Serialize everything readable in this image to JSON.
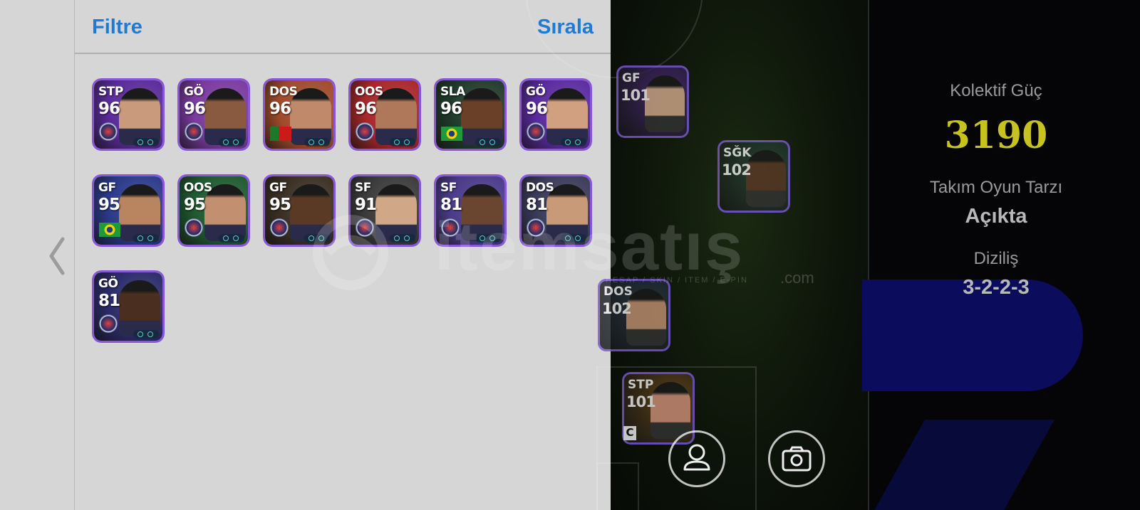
{
  "header": {
    "filter_label": "Filtre",
    "sort_label": "Sırala"
  },
  "colors": {
    "accent": "#1f7ad6",
    "panel_bg": "#d6d6d6",
    "power": "#c8c21e"
  },
  "player_list": [
    {
      "position": "STP",
      "rating": "96",
      "bg": "#5a2a9a",
      "face": "#c99a7c",
      "emblem": "psg-crest-icon"
    },
    {
      "position": "GÖ",
      "rating": "96",
      "bg": "#7a3aa0",
      "face": "#8a5a40",
      "emblem": "psg-crest-icon"
    },
    {
      "position": "DOS",
      "rating": "96",
      "bg": "#a04a2a",
      "face": "#c08a6a",
      "emblem": "portugal-flag-icon"
    },
    {
      "position": "OOS",
      "rating": "96",
      "bg": "#a8262a",
      "face": "#b0785a",
      "emblem": "red-crest-icon"
    },
    {
      "position": "SLA",
      "rating": "96",
      "bg": "#1f3a2a",
      "face": "#6a4028",
      "emblem": "brazil-flag-icon"
    },
    {
      "position": "GÖ",
      "rating": "96",
      "bg": "#5a2aa0",
      "face": "#d0a080",
      "emblem": "barcelona-crest-icon"
    },
    {
      "position": "GF",
      "rating": "95",
      "bg": "#2a3a8a",
      "face": "#b88560",
      "emblem": "brazil-flag-icon"
    },
    {
      "position": "OOS",
      "rating": "95",
      "bg": "#1e5a2e",
      "face": "#c29070",
      "emblem": "purple-crest-icon"
    },
    {
      "position": "GF",
      "rating": "95",
      "bg": "#3a2e22",
      "face": "#5a3a24",
      "emblem": "psg-crest-icon"
    },
    {
      "position": "SF",
      "rating": "91",
      "bg": "#3a3a3a",
      "face": "#d0a888",
      "emblem": "red-crest-icon"
    },
    {
      "position": "SF",
      "rating": "81",
      "bg": "#4a3a8a",
      "face": "#6a4530",
      "emblem": "blue-crest-icon"
    },
    {
      "position": "DOS",
      "rating": "81",
      "bg": "#3a3a5a",
      "face": "#c89a78",
      "emblem": "galatasaray-crest-icon"
    },
    {
      "position": "GÖ",
      "rating": "81",
      "bg": "#2a2a6a",
      "face": "#4a2e20",
      "emblem": "fenerbahce-crest-icon"
    }
  ],
  "pitch_cards": [
    {
      "position": "GF",
      "rating": "101",
      "bg": "#4a2a7a",
      "face": "#d0a88a"
    },
    {
      "position": "SĞK",
      "rating": "102",
      "bg": "#2a4a3a",
      "face": "#5a3a26"
    },
    {
      "position": "DOS",
      "rating": "102",
      "bg": "#2a3a4a",
      "face": "#c09070"
    },
    {
      "position": "STP",
      "rating": "101",
      "bg": "#6a4a1a",
      "face": "#d0907a",
      "badge": "C"
    }
  ],
  "team_stats": {
    "power_label": "Kolektif Güç",
    "power_value": "3190",
    "style_label": "Takım Oyun Tarzı",
    "style_value": "Açıkta",
    "formation_label": "Diziliş",
    "formation_value": "3-2-2-3"
  },
  "watermark": {
    "brand": "itemsatış",
    "tld": ".com",
    "tagline": "HESAP / SKIN / ITEM / E-PIN"
  }
}
